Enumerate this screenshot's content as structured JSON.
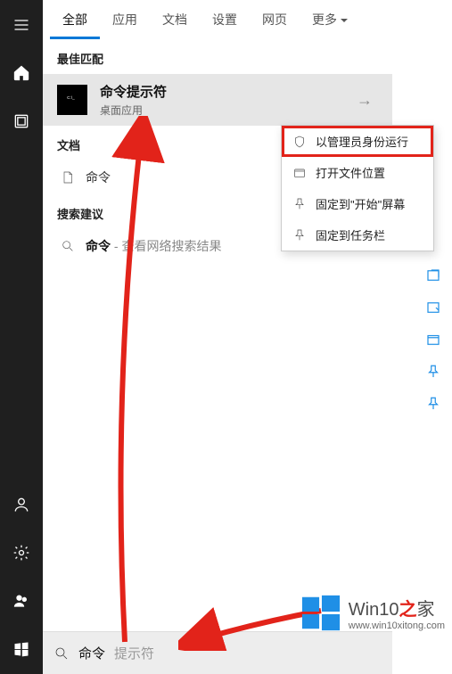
{
  "tabs": {
    "all": "全部",
    "apps": "应用",
    "docs": "文档",
    "settings": "设置",
    "web": "网页",
    "more": "更多"
  },
  "sections": {
    "best_match": "最佳匹配",
    "documents": "文档",
    "suggestions": "搜索建议"
  },
  "best_match": {
    "title": "命令提示符",
    "subtitle": "桌面应用"
  },
  "document_item": {
    "name": "命令"
  },
  "suggestion": {
    "query": "命令",
    "hint_prefix": " - ",
    "hint": "查看网络搜索结果"
  },
  "context_menu": {
    "run_admin": "以管理员身份运行",
    "open_location": "打开文件位置",
    "pin_start": "固定到\"开始\"屏幕",
    "pin_taskbar": "固定到任务栏"
  },
  "search_bar": {
    "typed": "命令",
    "ghost": "提示符"
  },
  "watermark": {
    "brand_a": "Win10",
    "brand_b": "之",
    "brand_c": "家",
    "url": "www.win10xitong.com"
  }
}
